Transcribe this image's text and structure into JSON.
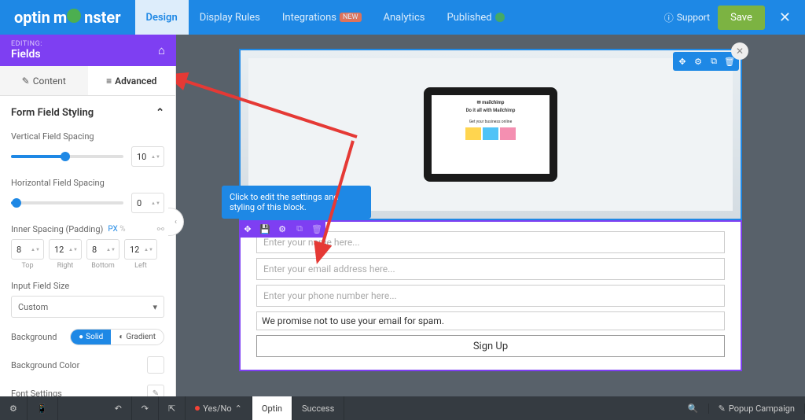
{
  "topbar": {
    "logo_prefix": "optin",
    "logo_suffix": "nster",
    "nav": [
      {
        "label": "Design",
        "active": true
      },
      {
        "label": "Display Rules"
      },
      {
        "label": "Integrations",
        "badge": "NEW"
      },
      {
        "label": "Analytics"
      },
      {
        "label": "Published",
        "status": true
      }
    ],
    "support": "Support",
    "save": "Save"
  },
  "editing": {
    "label": "EDITING:",
    "title": "Fields"
  },
  "tabs": {
    "content": "Content",
    "advanced": "Advanced"
  },
  "panel": {
    "section": "Form Field Styling",
    "vertical": {
      "label": "Vertical Field Spacing",
      "value": "10"
    },
    "horizontal": {
      "label": "Horizontal Field Spacing",
      "value": "0"
    },
    "padding": {
      "label": "Inner Spacing (Padding)",
      "px": "PX",
      "pct": "%",
      "top": {
        "v": "8",
        "l": "Top"
      },
      "right": {
        "v": "12",
        "l": "Right"
      },
      "bottom": {
        "v": "8",
        "l": "Bottom"
      },
      "left": {
        "v": "12",
        "l": "Left"
      }
    },
    "size": {
      "label": "Input Field Size",
      "value": "Custom"
    },
    "bg": {
      "label": "Background",
      "solid": "Solid",
      "gradient": "Gradient"
    },
    "bgcolor": "Background Color",
    "font": "Font Settings"
  },
  "tooltip": "Click to edit the settings and styling of this block.",
  "hero": {
    "brand": "mailchimp",
    "headline": "Do it all with Mailchimp",
    "sub": "Get your business online"
  },
  "form": {
    "name": "Enter your name here...",
    "email": "Enter your email address here...",
    "phone": "Enter your phone number here...",
    "privacy": "We promise not to use your email for spam.",
    "signup": "Sign Up"
  },
  "bottombar": {
    "yesno": "Yes/No",
    "optin": "Optin",
    "success": "Success",
    "campaign": "Popup Campaign"
  }
}
